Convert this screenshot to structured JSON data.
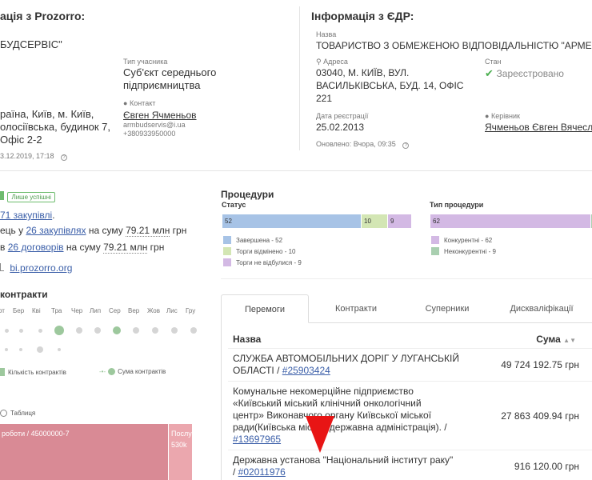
{
  "left": {
    "title": "ація з Prozorro:",
    "name": "БУДСЕРВІС\"",
    "participant_type_label": "Тип учасника",
    "participant_type_value": "Суб'єкт середнього підприємництва",
    "contact_label": "Контакт",
    "contact_name": "Євген Ячменьов",
    "contact_email": "armbudservis@i.ua",
    "contact_phone": "+380933950000",
    "address_lines": [
      "раїна, Київ, м. Київ,",
      "олосіївська, будинок 7,",
      "Офіс 2-2"
    ],
    "updated": "3.12.2019, 17:18"
  },
  "right": {
    "title": "Інформація з ЄДР:",
    "name_label": "Назва",
    "name_value": "ТОВАРИСТВО З ОБМЕЖЕНОЮ ВІДПОВІДАЛЬНІСТЮ \"АРМЕ",
    "address_label": "Адреса",
    "address_lines": [
      "03040, М. КИЇВ, ВУЛ.",
      "ВАСИЛЬКІВСЬКА, БУД. 14, ОФІС",
      "221"
    ],
    "state_label": "Стан",
    "state_value": "Зареєстровано",
    "reg_date_label": "Дата реєстрації",
    "reg_date_value": "25.02.2013",
    "head_label": "Керівник",
    "head_value": "Ячменьов Євген Вячесл",
    "updated": "Оновлено: Вчора, 09:35"
  },
  "summary": {
    "badge": "Лише успішні",
    "line1_link": "71 закупівлі",
    "line1_tail": ".",
    "line2_pre": "ець у",
    "line2_link": "26 закупівлях",
    "line2_mid": "на суму",
    "line2_amount": "79.21 млн",
    "line2_unit": "грн",
    "line3_pre": "в",
    "line3_link": "26 договорів",
    "line3_mid": "на суму",
    "line3_amount": "79.21 млн",
    "line3_unit": "грн",
    "bi_link": "bi.prozorro.org"
  },
  "contracts": {
    "title": "контракти",
    "months": [
      "от",
      "Бер",
      "Кві",
      "Тра",
      "Чер",
      "Лип",
      "Сер",
      "Вер",
      "Жов",
      "Лис",
      "Гру"
    ],
    "legend_count": "Кількість контрактів",
    "legend_sum": "Сума контрактів"
  },
  "tree": {
    "toggle_label": "Таблиця",
    "main_label": "роботи / 45000000-7",
    "side_label": "Послу",
    "side_value": "530k"
  },
  "procedures": {
    "title": "Процедури",
    "status_label": "Статус",
    "type_label": "Тип процедури",
    "status_values": [
      52,
      10,
      9
    ],
    "type_values": [
      62,
      9
    ],
    "status_legend": [
      "Завершена - 52",
      "Торги відмінено - 10",
      "Торги не відбулися - 9"
    ],
    "type_legend": [
      "Конкурентні - 62",
      "Неконкурентні - 9"
    ],
    "colors": {
      "blue": "#a7c3e6",
      "green": "#d3e6b4",
      "purple": "#d3b9e4",
      "teal": "#a9cfb0"
    }
  },
  "tabs": [
    "Перемоги",
    "Контракти",
    "Суперники",
    "Дискваліфікації"
  ],
  "table": {
    "col_name": "Назва",
    "col_sum": "Сума",
    "rows": [
      {
        "name_lines": [
          "СЛУЖБА АВТОМОБІЛЬНИХ ДОРІГ У ЛУГАНСЬКІЙ",
          "ОБЛАСТІ / "
        ],
        "id": "#25903424",
        "sum": "49 724 192.75 грн"
      },
      {
        "name_lines": [
          "Комунальне некомерційне підприємство",
          "«Київський міський клінічний онкологічний",
          "центр» Виконавчого органу Київської міської",
          "ради(Київська міська державна адміністрація). /"
        ],
        "id": "#13697965",
        "sum": "27 863 409.94 грн"
      },
      {
        "name_lines": [
          "Державна установа \"Національний інститут раку\"",
          "/ "
        ],
        "id": "#02011976",
        "sum": "916 120.00 грн"
      }
    ]
  }
}
